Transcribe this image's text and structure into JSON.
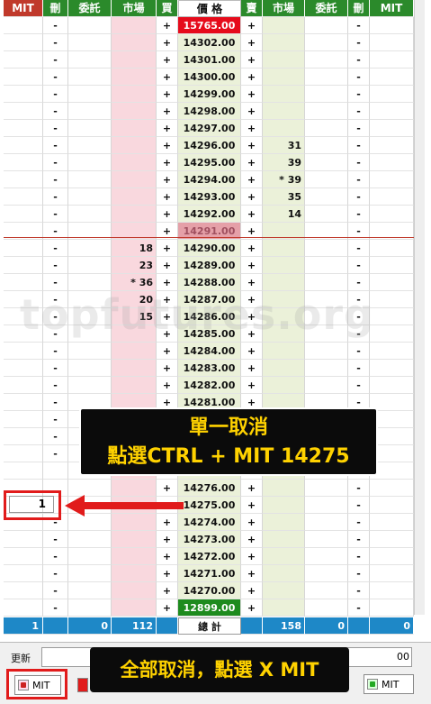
{
  "headers": [
    "MIT",
    "刪",
    "委託",
    "市場",
    "買",
    "價 格",
    "賣",
    "市場",
    "委託",
    "刪",
    "MIT"
  ],
  "rows": [
    {
      "bmit": "",
      "del_l": "-",
      "bord": "",
      "bmkt": "",
      "buy": "+",
      "price": "15765.00",
      "sell": "+",
      "smkt": "",
      "sord": "",
      "del_r": "-",
      "smit": ""
    },
    {
      "bmit": "",
      "del_l": "-",
      "bord": "",
      "bmkt": "",
      "buy": "+",
      "price": "14302.00",
      "sell": "+",
      "smkt": "",
      "sord": "",
      "del_r": "-",
      "smit": ""
    },
    {
      "bmit": "",
      "del_l": "-",
      "bord": "",
      "bmkt": "",
      "buy": "+",
      "price": "14301.00",
      "sell": "+",
      "smkt": "",
      "sord": "",
      "del_r": "-",
      "smit": ""
    },
    {
      "bmit": "",
      "del_l": "-",
      "bord": "",
      "bmkt": "",
      "buy": "+",
      "price": "14300.00",
      "sell": "+",
      "smkt": "",
      "sord": "",
      "del_r": "-",
      "smit": ""
    },
    {
      "bmit": "",
      "del_l": "-",
      "bord": "",
      "bmkt": "",
      "buy": "+",
      "price": "14299.00",
      "sell": "+",
      "smkt": "",
      "sord": "",
      "del_r": "-",
      "smit": ""
    },
    {
      "bmit": "",
      "del_l": "-",
      "bord": "",
      "bmkt": "",
      "buy": "+",
      "price": "14298.00",
      "sell": "+",
      "smkt": "",
      "sord": "",
      "del_r": "-",
      "smit": ""
    },
    {
      "bmit": "",
      "del_l": "-",
      "bord": "",
      "bmkt": "",
      "buy": "+",
      "price": "14297.00",
      "sell": "+",
      "smkt": "",
      "sord": "",
      "del_r": "-",
      "smit": ""
    },
    {
      "bmit": "",
      "del_l": "-",
      "bord": "",
      "bmkt": "",
      "buy": "+",
      "price": "14296.00",
      "sell": "+",
      "smkt": "31",
      "sord": "",
      "del_r": "-",
      "smit": ""
    },
    {
      "bmit": "",
      "del_l": "-",
      "bord": "",
      "bmkt": "",
      "buy": "+",
      "price": "14295.00",
      "sell": "+",
      "smkt": "39",
      "sord": "",
      "del_r": "-",
      "smit": ""
    },
    {
      "bmit": "",
      "del_l": "-",
      "bord": "",
      "bmkt": "",
      "buy": "+",
      "price": "14294.00",
      "sell": "+",
      "smkt": "* 39",
      "sord": "",
      "del_r": "-",
      "smit": ""
    },
    {
      "bmit": "",
      "del_l": "-",
      "bord": "",
      "bmkt": "",
      "buy": "+",
      "price": "14293.00",
      "sell": "+",
      "smkt": "35",
      "sord": "",
      "del_r": "-",
      "smit": ""
    },
    {
      "bmit": "",
      "del_l": "-",
      "bord": "",
      "bmkt": "",
      "buy": "+",
      "price": "14292.00",
      "sell": "+",
      "smkt": "14",
      "sord": "",
      "del_r": "-",
      "smit": ""
    },
    {
      "bmit": "",
      "del_l": "-",
      "bord": "",
      "bmkt": "",
      "buy": "+",
      "price": "14291.00",
      "sell": "+",
      "smkt": "",
      "sord": "",
      "del_r": "-",
      "smit": ""
    },
    {
      "bmit": "",
      "del_l": "-",
      "bord": "",
      "bmkt": "18",
      "buy": "+",
      "price": "14290.00",
      "sell": "+",
      "smkt": "",
      "sord": "",
      "del_r": "-",
      "smit": ""
    },
    {
      "bmit": "",
      "del_l": "-",
      "bord": "",
      "bmkt": "23",
      "buy": "+",
      "price": "14289.00",
      "sell": "+",
      "smkt": "",
      "sord": "",
      "del_r": "-",
      "smit": ""
    },
    {
      "bmit": "",
      "del_l": "-",
      "bord": "",
      "bmkt": "* 36",
      "buy": "+",
      "price": "14288.00",
      "sell": "+",
      "smkt": "",
      "sord": "",
      "del_r": "-",
      "smit": ""
    },
    {
      "bmit": "",
      "del_l": "-",
      "bord": "",
      "bmkt": "20",
      "buy": "+",
      "price": "14287.00",
      "sell": "+",
      "smkt": "",
      "sord": "",
      "del_r": "-",
      "smit": ""
    },
    {
      "bmit": "",
      "del_l": "-",
      "bord": "",
      "bmkt": "15",
      "buy": "+",
      "price": "14286.00",
      "sell": "+",
      "smkt": "",
      "sord": "",
      "del_r": "-",
      "smit": ""
    },
    {
      "bmit": "",
      "del_l": "-",
      "bord": "",
      "bmkt": "",
      "buy": "+",
      "price": "14285.00",
      "sell": "+",
      "smkt": "",
      "sord": "",
      "del_r": "-",
      "smit": ""
    },
    {
      "bmit": "",
      "del_l": "-",
      "bord": "",
      "bmkt": "",
      "buy": "+",
      "price": "14284.00",
      "sell": "+",
      "smkt": "",
      "sord": "",
      "del_r": "-",
      "smit": ""
    },
    {
      "bmit": "",
      "del_l": "-",
      "bord": "",
      "bmkt": "",
      "buy": "+",
      "price": "14283.00",
      "sell": "+",
      "smkt": "",
      "sord": "",
      "del_r": "-",
      "smit": ""
    },
    {
      "bmit": "",
      "del_l": "-",
      "bord": "",
      "bmkt": "",
      "buy": "+",
      "price": "14282.00",
      "sell": "+",
      "smkt": "",
      "sord": "",
      "del_r": "-",
      "smit": ""
    },
    {
      "bmit": "",
      "del_l": "-",
      "bord": "",
      "bmkt": "",
      "buy": "+",
      "price": "14281.00",
      "sell": "+",
      "smkt": "",
      "sord": "",
      "del_r": "-",
      "smit": ""
    },
    {
      "bmit": "",
      "del_l": "-",
      "bord": "",
      "bmkt": "",
      "buy": "",
      "price": "",
      "sell": "",
      "smkt": "",
      "sord": "",
      "del_r": "-",
      "smit": ""
    },
    {
      "bmit": "",
      "del_l": "-",
      "bord": "",
      "bmkt": "",
      "buy": "",
      "price": "",
      "sell": "",
      "smkt": "",
      "sord": "",
      "del_r": "-",
      "smit": ""
    },
    {
      "bmit": "",
      "del_l": "-",
      "bord": "",
      "bmkt": "",
      "buy": "",
      "price": "",
      "sell": "",
      "smkt": "",
      "sord": "",
      "del_r": "-",
      "smit": ""
    },
    {
      "bmit": "",
      "del_l": "",
      "bord": "",
      "bmkt": "",
      "buy": "",
      "price": "",
      "sell": "",
      "smkt": "",
      "sord": "",
      "del_r": "-",
      "smit": ""
    },
    {
      "bmit": "",
      "del_l": "",
      "bord": "",
      "bmkt": "",
      "buy": "+",
      "price": "14276.00",
      "sell": "+",
      "smkt": "",
      "sord": "",
      "del_r": "-",
      "smit": ""
    },
    {
      "bmit": "",
      "del_l": "",
      "bord": "",
      "bmkt": "",
      "buy": "+",
      "price": "14275.00",
      "sell": "+",
      "smkt": "",
      "sord": "",
      "del_r": "-",
      "smit": ""
    },
    {
      "bmit": "",
      "del_l": "-",
      "bord": "",
      "bmkt": "",
      "buy": "+",
      "price": "14274.00",
      "sell": "+",
      "smkt": "",
      "sord": "",
      "del_r": "-",
      "smit": ""
    },
    {
      "bmit": "",
      "del_l": "-",
      "bord": "",
      "bmkt": "",
      "buy": "+",
      "price": "14273.00",
      "sell": "+",
      "smkt": "",
      "sord": "",
      "del_r": "-",
      "smit": ""
    },
    {
      "bmit": "",
      "del_l": "-",
      "bord": "",
      "bmkt": "",
      "buy": "+",
      "price": "14272.00",
      "sell": "+",
      "smkt": "",
      "sord": "",
      "del_r": "-",
      "smit": ""
    },
    {
      "bmit": "",
      "del_l": "-",
      "bord": "",
      "bmkt": "",
      "buy": "+",
      "price": "14271.00",
      "sell": "+",
      "smkt": "",
      "sord": "",
      "del_r": "-",
      "smit": ""
    },
    {
      "bmit": "",
      "del_l": "-",
      "bord": "",
      "bmkt": "",
      "buy": "+",
      "price": "14270.00",
      "sell": "+",
      "smkt": "",
      "sord": "",
      "del_r": "-",
      "smit": ""
    },
    {
      "bmit": "",
      "del_l": "-",
      "bord": "",
      "bmkt": "",
      "buy": "+",
      "price": "12899.00",
      "sell": "+",
      "smkt": "",
      "sord": "",
      "del_r": "-",
      "smit": ""
    }
  ],
  "totals": {
    "bmit": "1",
    "del_l": "",
    "bord": "0",
    "bmkt": "112",
    "buy": "",
    "price": "總 計",
    "sell": "",
    "smkt": "158",
    "sord": "0",
    "del_r": "",
    "smit": "0"
  },
  "last_price": "14291.00",
  "watermark": "topfutures.org",
  "callout_single": {
    "line1": "單一取消",
    "line2": "點選CTRL + MIT  14275"
  },
  "callout_all": "全部取消，點選 X MIT",
  "mit_input_value": "1",
  "bottom": {
    "refresh_label": "更新",
    "right_field": "00",
    "mit_left": "MIT",
    "mit_right": "MIT"
  }
}
